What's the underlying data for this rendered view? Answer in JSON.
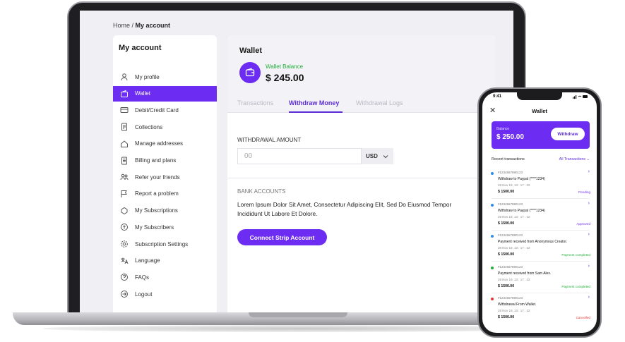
{
  "breadcrumb": {
    "home": "Home",
    "separator": " / ",
    "current": "My account"
  },
  "sidebar": {
    "title": "My account",
    "items": [
      {
        "label": "My profile",
        "icon": "user-icon",
        "active": false
      },
      {
        "label": "Wallet",
        "icon": "wallet-icon",
        "active": true
      },
      {
        "label": "Debit/Credit Card",
        "icon": "credit-card-icon",
        "active": false
      },
      {
        "label": "Collections",
        "icon": "collections-icon",
        "active": false
      },
      {
        "label": "Manage addresses",
        "icon": "home-icon",
        "active": false
      },
      {
        "label": "Billing and plans",
        "icon": "billing-icon",
        "active": false
      },
      {
        "label": "Refer your friends",
        "icon": "friends-icon",
        "active": false
      },
      {
        "label": "Report a problem",
        "icon": "report-icon",
        "active": false
      },
      {
        "label": "My Subscriptions",
        "icon": "subscriptions-icon",
        "active": false
      },
      {
        "label": "My Subscribers",
        "icon": "subscribers-icon",
        "active": false
      },
      {
        "label": "Subscription Settings",
        "icon": "settings-icon",
        "active": false
      },
      {
        "label": "Language",
        "icon": "language-icon",
        "active": false
      },
      {
        "label": "FAQs",
        "icon": "help-icon",
        "active": false
      },
      {
        "label": "Logout",
        "icon": "logout-icon",
        "active": false
      }
    ]
  },
  "main": {
    "title": "Wallet",
    "balance_label": "Wallet Balance",
    "balance": "$ 245.00",
    "tabs": [
      {
        "label": "Transactions",
        "active": false
      },
      {
        "label": "Withdraw Money",
        "active": true
      },
      {
        "label": "Withdrawal Logs",
        "active": false
      }
    ],
    "amount_label": "WITHDRAWAL AMOUNT",
    "amount_placeholder": "00",
    "currency": "USD",
    "bank_label": "BANK ACCOUNTS",
    "bank_text": "Lorem Ipsum Dolor Sit Amet, Consectetur Adipiscing Elit, Sed Do Eiusmod Tempor Incididunt Ut Labore Et Dolore.",
    "connect_button": "Connect Strip Account"
  },
  "phone": {
    "time": "9:41",
    "title": "Wallet",
    "balance_label": "Balance",
    "balance": "$ 250.00",
    "withdraw_button": "Withdraw",
    "recent_label": "Recent transactions",
    "all_label": "All Transactions",
    "transactions": [
      {
        "id": "#1234567890123",
        "desc": "Withdraw to Paypal (****1234)",
        "date": "28 Nov 19, 13 : 17 : 22",
        "amount": "$ 1500.00",
        "status": "Pending",
        "status_color": "#6c2cf2",
        "dot_color": "#2f8cf0"
      },
      {
        "id": "#1234567890123",
        "desc": "Withdraw to Paypal (****1234)",
        "date": "28 Nov 19, 13 : 17 : 22",
        "amount": "$ 1500.00",
        "status": "Approved",
        "status_color": "#6c2cf2",
        "dot_color": "#2f8cf0"
      },
      {
        "id": "#1234567890123",
        "desc": "Payment received from Anonymous Creator.",
        "date": "28 Nov 19, 13 : 17 : 22",
        "amount": "$ 1500.00",
        "status": "Payment completed",
        "status_color": "#1fae38",
        "dot_color": "#2f8cf0"
      },
      {
        "id": "#1234567890123",
        "desc": "Payment received from Sam Alex.",
        "date": "28 Nov 19, 13 : 17 : 22",
        "amount": "$ 1500.00",
        "status": "Payment completed",
        "status_color": "#1fae38",
        "dot_color": "#1fae38"
      },
      {
        "id": "#1234567890123",
        "desc": "Withdrawal From Wallet.",
        "date": "28 Nov 19, 13 : 17 : 22",
        "amount": "$ 1500.00",
        "status": "Cancelled",
        "status_color": "#e53935",
        "dot_color": "#e53935"
      }
    ]
  },
  "colors": {
    "accent": "#6c2cf2",
    "success": "#1fae38",
    "danger": "#e53935"
  }
}
